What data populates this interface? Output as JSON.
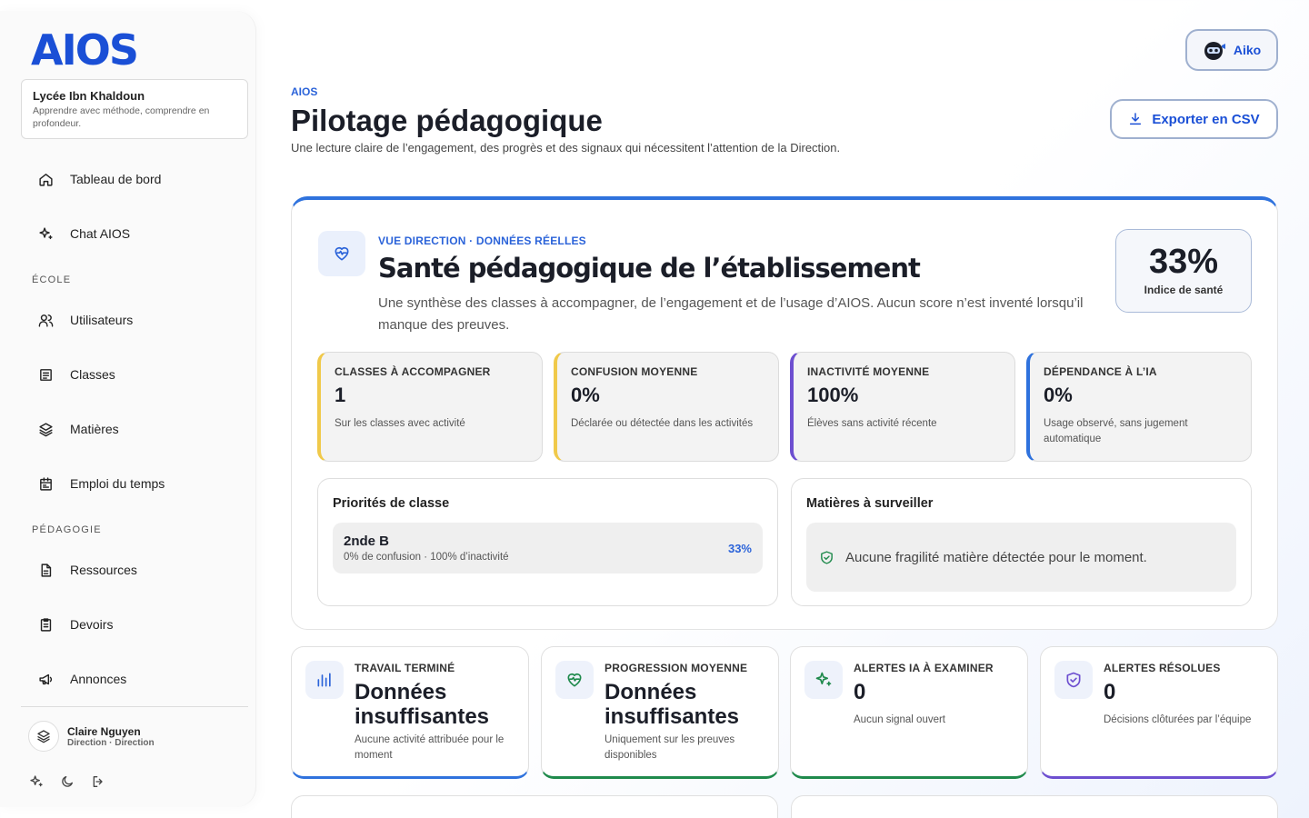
{
  "brand": {
    "logo": "AIOS"
  },
  "school": {
    "name": "Lycée Ibn Khaldoun",
    "motto": "Apprendre avec méthode, comprendre en profondeur."
  },
  "nav": {
    "top_items": [
      {
        "label": "Tableau de bord",
        "icon": "home-icon"
      },
      {
        "label": "Chat AIOS",
        "icon": "sparkles-icon"
      }
    ],
    "sections": [
      {
        "title": "ÉCOLE",
        "items": [
          {
            "label": "Utilisateurs",
            "icon": "users-icon"
          },
          {
            "label": "Classes",
            "icon": "list-icon"
          },
          {
            "label": "Matières",
            "icon": "layers-icon"
          },
          {
            "label": "Emploi du temps",
            "icon": "calendar-icon"
          }
        ]
      },
      {
        "title": "PÉDAGOGIE",
        "items": [
          {
            "label": "Ressources",
            "icon": "file-icon"
          },
          {
            "label": "Devoirs",
            "icon": "clipboard-icon"
          },
          {
            "label": "Annonces",
            "icon": "megaphone-icon"
          }
        ]
      }
    ]
  },
  "user": {
    "name": "Claire Nguyen",
    "role": "Direction · Direction"
  },
  "sidebar_tools": [
    "sparkles-icon",
    "moon-icon",
    "logout-icon"
  ],
  "header": {
    "assistant_label": "Aiko",
    "breadcrumb": "AIOS",
    "title": "Pilotage pédagogique",
    "subtitle": "Une lecture claire de l’engagement, des progrès et des signaux qui nécessitent l’attention de la Direction.",
    "export_label": "Exporter en CSV"
  },
  "health": {
    "kicker": "VUE DIRECTION · DONNÉES RÉELLES",
    "title": "Santé pédagogique de l’établissement",
    "description": "Une synthèse des classes à accompagner, de l’engagement et de l’usage d’AIOS. Aucun score n’est inventé lorsqu’il manque des preuves.",
    "score_value": "33%",
    "score_label": "Indice de santé",
    "metrics": [
      {
        "label": "CLASSES À ACCOMPAGNER",
        "value": "1",
        "help": "Sur les classes avec activité",
        "accent": "#f0c94a"
      },
      {
        "label": "CONFUSION MOYENNE",
        "value": "0%",
        "help": "Déclarée ou détectée dans les activités",
        "accent": "#f0c94a"
      },
      {
        "label": "INACTIVITÉ MOYENNE",
        "value": "100%",
        "help": "Élèves sans activité récente",
        "accent": "#6d4fd0"
      },
      {
        "label": "DÉPENDANCE À L’IA",
        "value": "0%",
        "help": "Usage observé, sans jugement automatique",
        "accent": "#2f72dd"
      }
    ],
    "priorities": {
      "title": "Priorités de classe",
      "rows": [
        {
          "class": "2nde B",
          "meta": "0% de confusion · 100% d’inactivité",
          "pct": "33%"
        }
      ]
    },
    "subjects": {
      "title": "Matières à surveiller",
      "empty": "Aucune fragilité matière détectée pour le moment."
    }
  },
  "kpis": [
    {
      "label": "TRAVAIL TERMINÉ",
      "value": "Données insuffisantes",
      "help": "Aucune activité attribuée pour le moment",
      "icon": "bar-chart-icon",
      "accent": "#2f72dd"
    },
    {
      "label": "PROGRESSION MOYENNE",
      "value": "Données insuffisantes",
      "help": "Uniquement sur les preuves disponibles",
      "icon": "heart-pulse-icon",
      "accent": "#1f8a4c"
    },
    {
      "label": "ALERTES IA À EXAMINER",
      "value": "0",
      "help": "Aucun signal ouvert",
      "icon": "sparkles-icon",
      "accent": "#1f8a4c"
    },
    {
      "label": "ALERTES RÉSOLUES",
      "value": "0",
      "help": "Décisions clôturées par l’équipe",
      "icon": "shield-check-icon",
      "accent": "#6d4fd0"
    }
  ]
}
